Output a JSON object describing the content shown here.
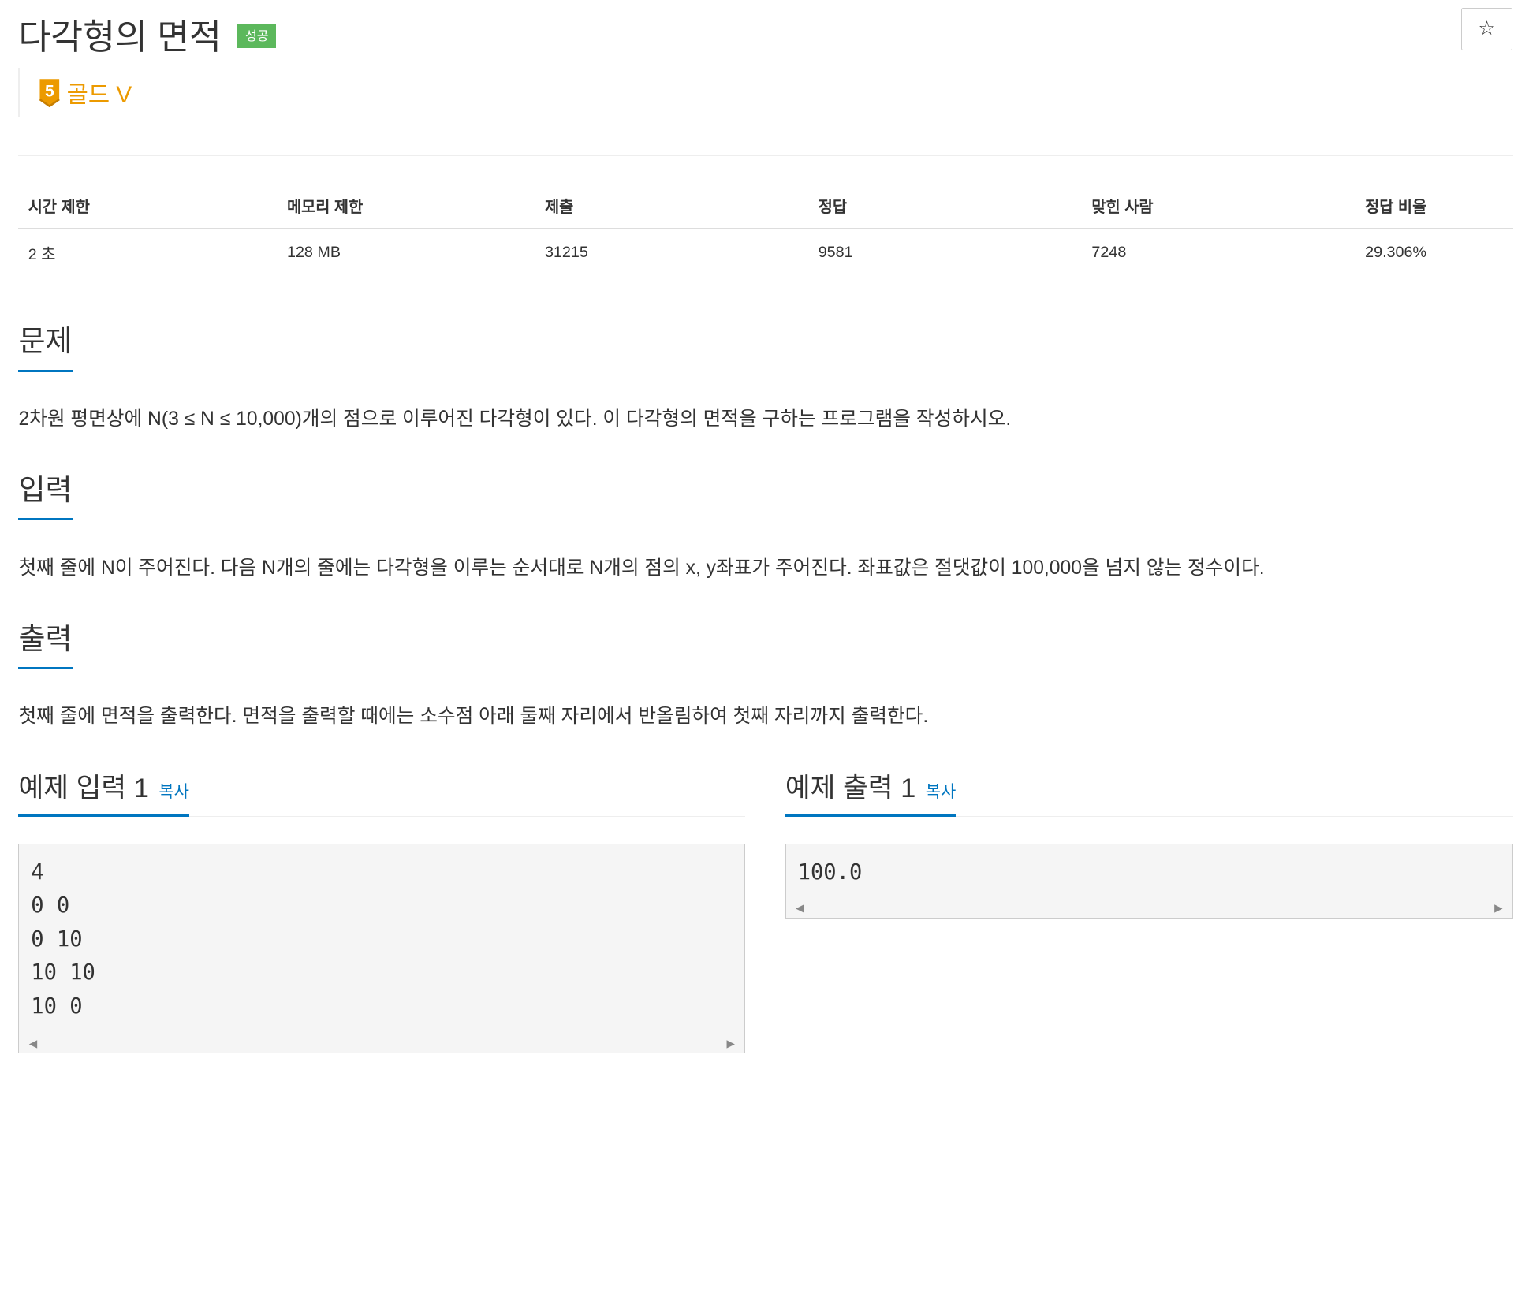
{
  "problem": {
    "title": "다각형의 면적",
    "result_badge": "성공",
    "star_label": "☆",
    "tier_number": "5",
    "tier_label": "골드 V",
    "tier_color": "#ec9a00"
  },
  "info_table": {
    "headers": [
      "시간 제한",
      "메모리 제한",
      "제출",
      "정답",
      "맞힌 사람",
      "정답 비율"
    ],
    "values": [
      "2 초",
      "128 MB",
      "31215",
      "9581",
      "7248",
      "29.306%"
    ]
  },
  "sections": {
    "problem": {
      "heading": "문제",
      "body": "2차원 평면상에 N(3 ≤ N ≤ 10,000)개의 점으로 이루어진 다각형이 있다. 이 다각형의 면적을 구하는 프로그램을 작성하시오."
    },
    "input": {
      "heading": "입력",
      "body": "첫째 줄에 N이 주어진다. 다음 N개의 줄에는 다각형을 이루는 순서대로 N개의 점의 x, y좌표가 주어진다. 좌표값은 절댓값이 100,000을 넘지 않는 정수이다."
    },
    "output": {
      "heading": "출력",
      "body": "첫째 줄에 면적을 출력한다. 면적을 출력할 때에는 소수점 아래 둘째 자리에서 반올림하여 첫째 자리까지 출력한다."
    }
  },
  "samples": {
    "input": {
      "heading": "예제 입력 1",
      "copy_label": "복사",
      "content": "4\n0 0\n0 10\n10 10\n10 0"
    },
    "output": {
      "heading": "예제 출력 1",
      "copy_label": "복사",
      "content": "100.0"
    }
  },
  "colors": {
    "accent": "#0076c0",
    "success": "#5cb85c"
  }
}
